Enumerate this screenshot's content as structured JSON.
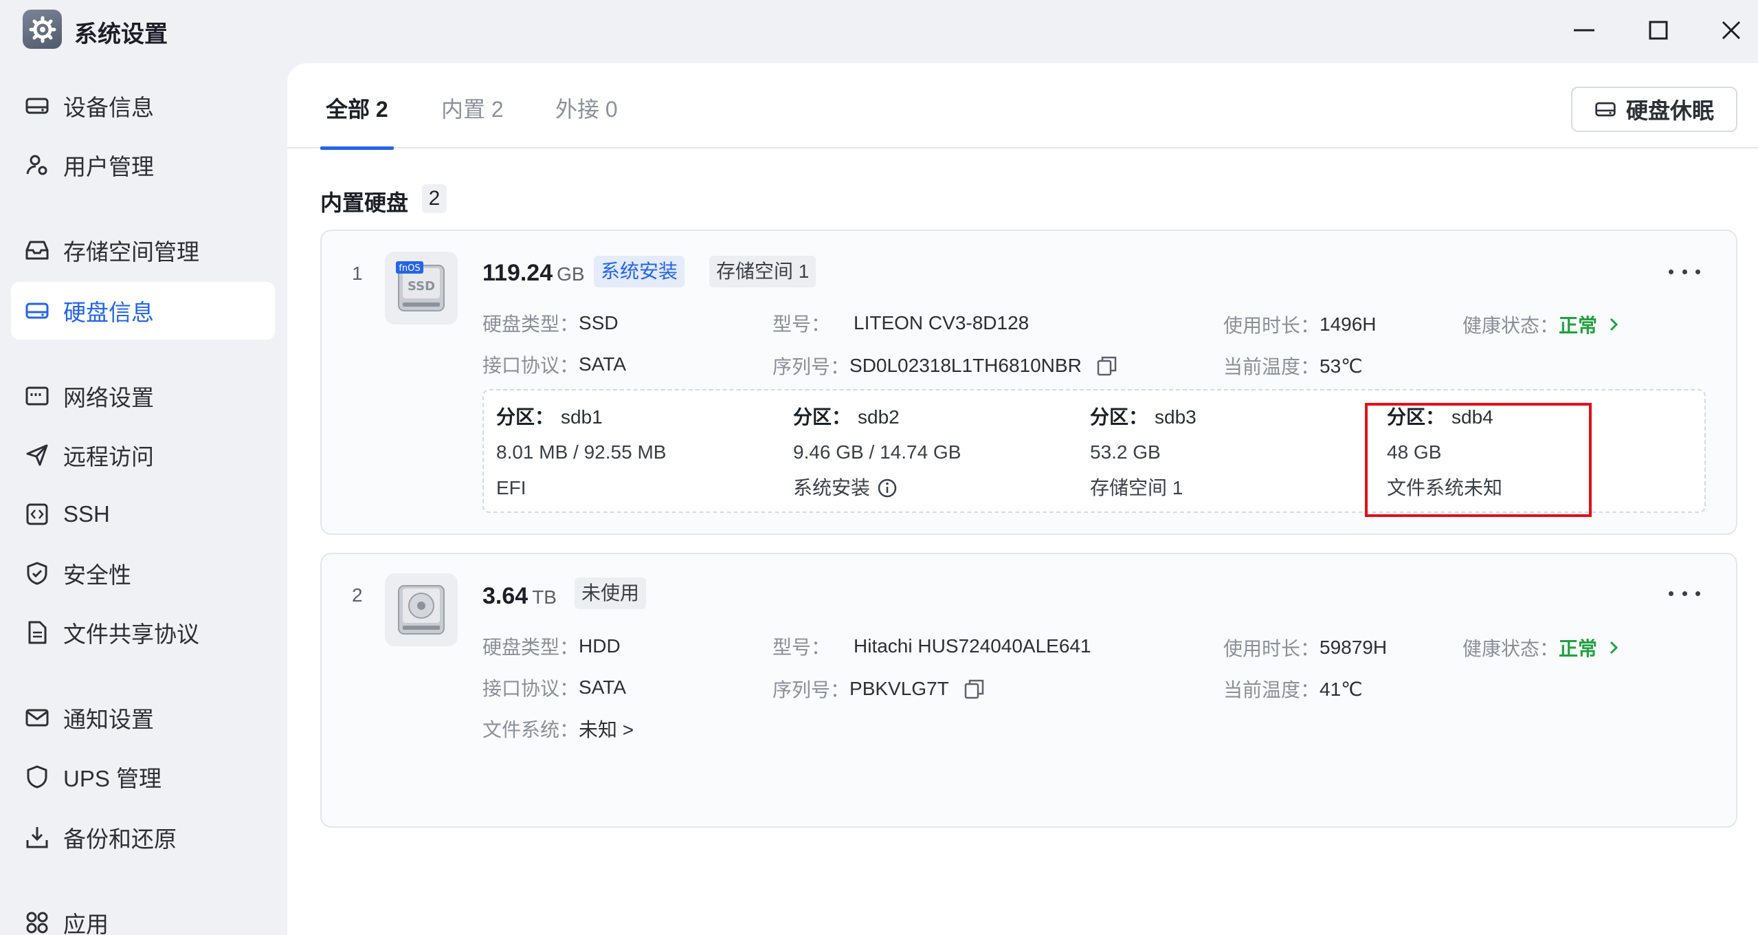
{
  "window": {
    "title": "系统设置",
    "icons": {
      "app": "gear-icon",
      "minimize": "minimize-icon",
      "maximize": "maximize-icon",
      "close": "close-icon"
    }
  },
  "sidebar": {
    "items": [
      {
        "label": "设备信息",
        "icon": "drive-icon",
        "active": false
      },
      {
        "label": "用户管理",
        "icon": "user-icon",
        "active": false
      },
      {
        "label": "存储空间管理",
        "icon": "inbox-icon",
        "active": false
      },
      {
        "label": "硬盘信息",
        "icon": "drive-icon",
        "active": true
      },
      {
        "label": "网络设置",
        "icon": "network-icon",
        "active": false
      },
      {
        "label": "远程访问",
        "icon": "send-icon",
        "active": false
      },
      {
        "label": "SSH",
        "icon": "code-icon",
        "active": false
      },
      {
        "label": "安全性",
        "icon": "shield-check-icon",
        "active": false
      },
      {
        "label": "文件共享协议",
        "icon": "file-icon",
        "active": false
      },
      {
        "label": "通知设置",
        "icon": "mail-icon",
        "active": false
      },
      {
        "label": "UPS 管理",
        "icon": "shield-icon",
        "active": false
      },
      {
        "label": "备份和还原",
        "icon": "download-icon",
        "active": false
      },
      {
        "label": "应用",
        "icon": "apps-icon",
        "active": false
      }
    ]
  },
  "main": {
    "tabs": [
      {
        "label": "全部 2",
        "active": true
      },
      {
        "label": "内置 2",
        "active": false
      },
      {
        "label": "外接 0",
        "active": false
      }
    ],
    "sleep_button": "硬盘休眠",
    "section": {
      "title": "内置硬盘",
      "count": "2"
    },
    "disks": [
      {
        "index": "1",
        "image_badge": "fnOS",
        "image_label": "SSD",
        "capacity": "119.24",
        "unit": "GB",
        "tags": [
          "系统安装",
          "存储空间 1"
        ],
        "type_label": "硬盘类型：",
        "type": "SSD",
        "model_label": "型号：",
        "model": "LITEON CV3-8D128",
        "hours_label": "使用时长：",
        "hours": "1496H",
        "health_label": "健康状态：",
        "health": "正常",
        "interface_label": "接口协议：",
        "interface": "SATA",
        "serial_label": "序列号：",
        "serial": "SD0L02318L1TH6810NBR",
        "temp_label": "当前温度：",
        "temp": "53℃",
        "partitions": [
          {
            "key": "分区：",
            "name": "sdb1",
            "size": "8.01 MB / 92.55 MB",
            "usage": "EFI"
          },
          {
            "key": "分区：",
            "name": "sdb2",
            "size": "9.46 GB / 14.74 GB",
            "usage": "系统安装"
          },
          {
            "key": "分区：",
            "name": "sdb3",
            "size": "53.2 GB",
            "usage": "存储空间 1"
          },
          {
            "key": "分区：",
            "name": "sdb4",
            "size": "48 GB",
            "usage": "文件系统未知"
          }
        ]
      },
      {
        "index": "2",
        "capacity": "3.64",
        "unit": "TB",
        "tags": [
          "未使用"
        ],
        "type_label": "硬盘类型：",
        "type": "HDD",
        "model_label": "型号：",
        "model": "Hitachi HUS724040ALE641",
        "hours_label": "使用时长：",
        "hours": "59879H",
        "health_label": "健康状态：",
        "health": "正常",
        "interface_label": "接口协议：",
        "interface": "SATA",
        "serial_label": "序列号：",
        "serial": "PBKVLG7T",
        "temp_label": "当前温度：",
        "temp": "41℃",
        "fs_label": "文件系统：",
        "fs": "未知 >"
      }
    ]
  },
  "colors": {
    "accent": "#2563eb",
    "ok": "#22a040",
    "highlight": "#e0101a"
  }
}
